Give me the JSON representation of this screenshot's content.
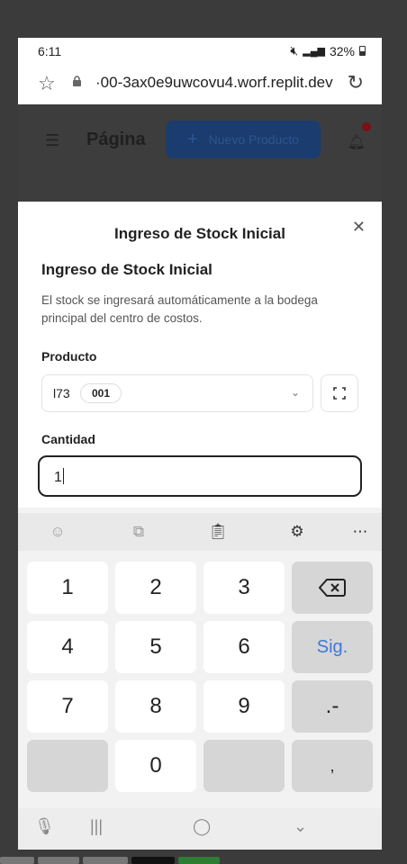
{
  "status_bar": {
    "time": "6:11",
    "battery": "32%"
  },
  "browser": {
    "url": "·00-3ax0e9uwcovu4.worf.replit.dev"
  },
  "app_header": {
    "title": "Página",
    "new_button": "Nuevo Producto"
  },
  "modal": {
    "title": "Ingreso de Stock Inicial",
    "heading": "Ingreso de Stock Inicial",
    "description": "El stock se ingresará automáticamente a la bodega principal del centro de costos.",
    "product_label": "Producto",
    "product_value": "l73",
    "product_code": "001",
    "quantity_label": "Cantidad",
    "quantity_value": "1"
  },
  "keyboard": {
    "rows": [
      [
        "1",
        "2",
        "3",
        "⌫"
      ],
      [
        "4",
        "5",
        "6",
        "Sig."
      ],
      [
        "7",
        "8",
        "9",
        ".-"
      ],
      [
        "",
        "0",
        "",
        ","
      ]
    ]
  },
  "colors": {
    "primary_button": "#1a3c6e",
    "notification": "#7a1010",
    "accent_key": "#3f79d6"
  },
  "icons": [
    "star-icon",
    "lock-icon",
    "reload-icon",
    "menu-icon",
    "plus-icon",
    "bell-icon",
    "close-icon",
    "chevron-down-icon",
    "scan-icon",
    "emoji-icon",
    "translate-icon",
    "clipboard-icon",
    "settings-icon",
    "more-icon",
    "backspace-icon",
    "mic-icon"
  ]
}
